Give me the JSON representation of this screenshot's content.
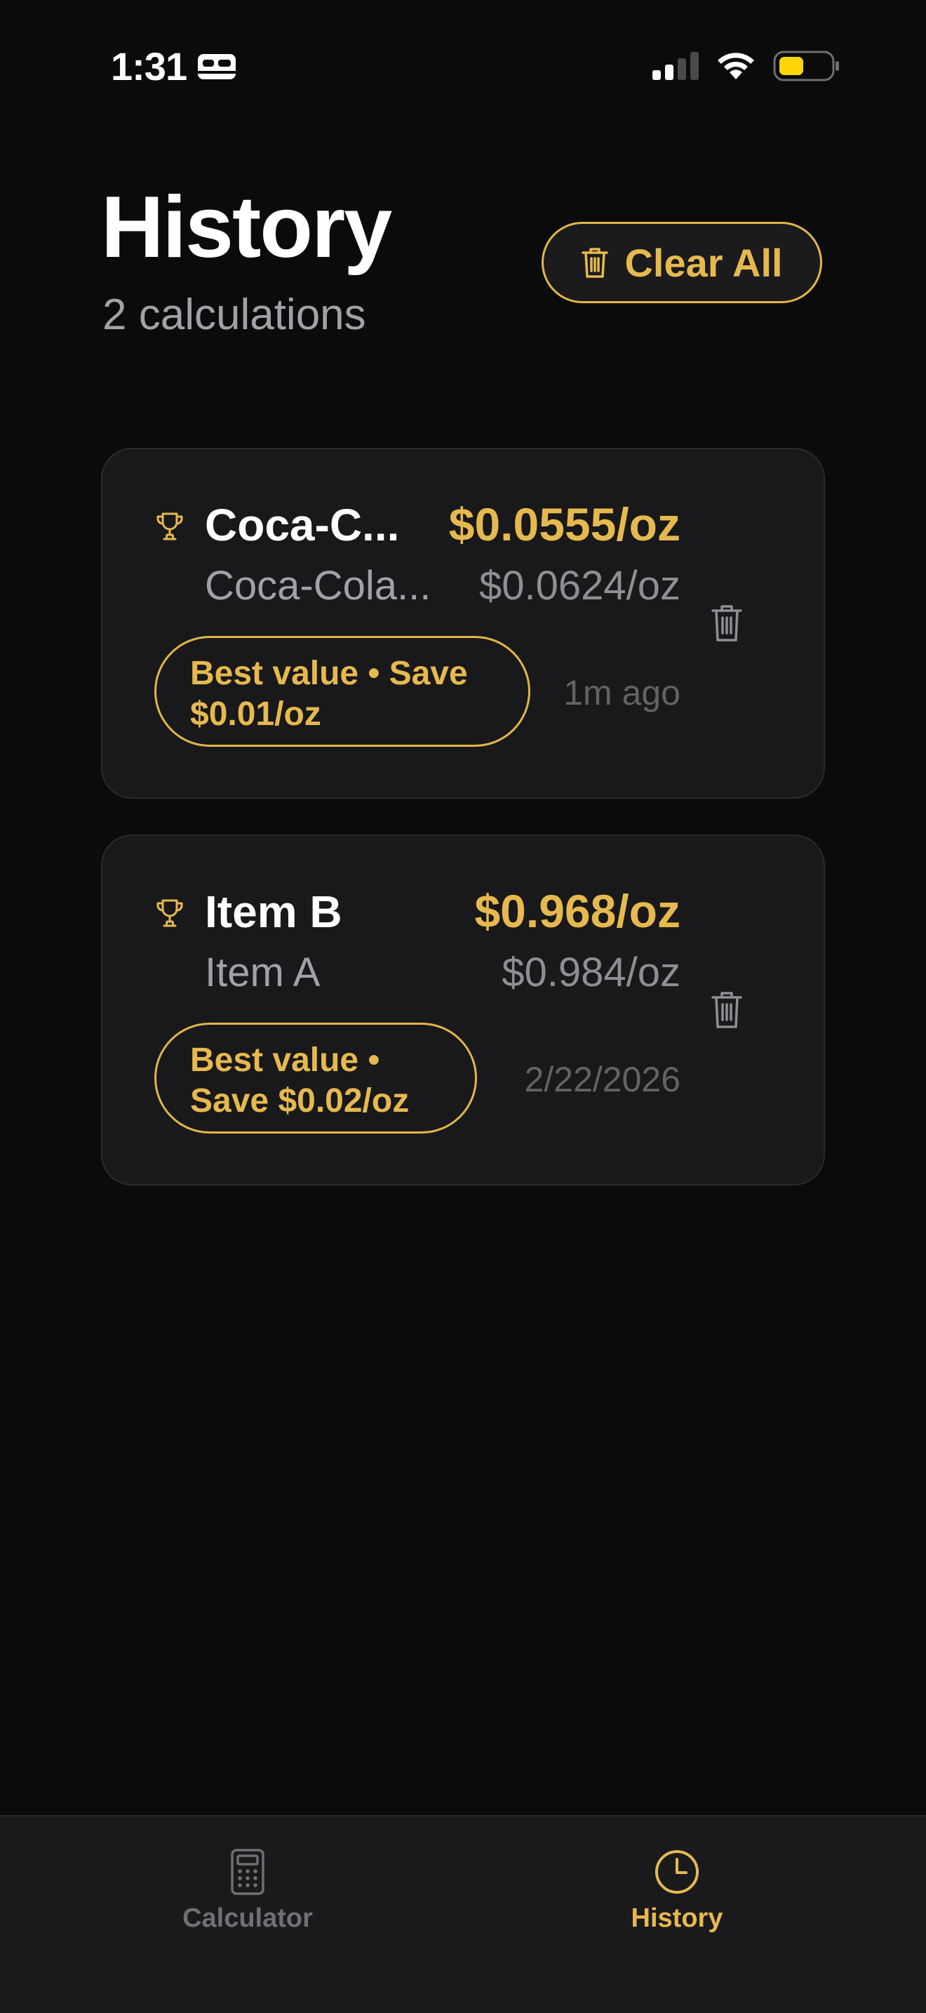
{
  "status_bar": {
    "time": "1:31",
    "sleep_icon": "bed-icon",
    "signal_icon": "cellular-signal-icon",
    "wifi_icon": "wifi-icon",
    "battery_icon": "battery-icon",
    "battery_color": "#ffd60a"
  },
  "header": {
    "title": "History",
    "subtitle": "2 calculations",
    "clear_all_label": "Clear All",
    "clear_all_icon": "trash-icon"
  },
  "history": [
    {
      "winner_name": "Coca-C...",
      "winner_price": "$0.0555/oz",
      "other_name": "Coca-Cola...",
      "other_price": "$0.0624/oz",
      "badge": "Best value • Save $0.01/oz",
      "timestamp": "1m ago"
    },
    {
      "winner_name": "Item B",
      "winner_price": "$0.968/oz",
      "other_name": "Item A",
      "other_price": "$0.984/oz",
      "badge": "Best value • Save $0.02/oz",
      "timestamp": "2/22/2026"
    }
  ],
  "tab_bar": {
    "tabs": [
      {
        "label": "Calculator",
        "icon": "calculator-icon",
        "active": false
      },
      {
        "label": "History",
        "icon": "clock-icon",
        "active": true
      }
    ]
  },
  "colors": {
    "background": "#0b0b0c",
    "card": "#19191b",
    "accent": "#e6b94f",
    "secondary_text": "#a1a1a7",
    "tertiary_text": "#636366"
  }
}
